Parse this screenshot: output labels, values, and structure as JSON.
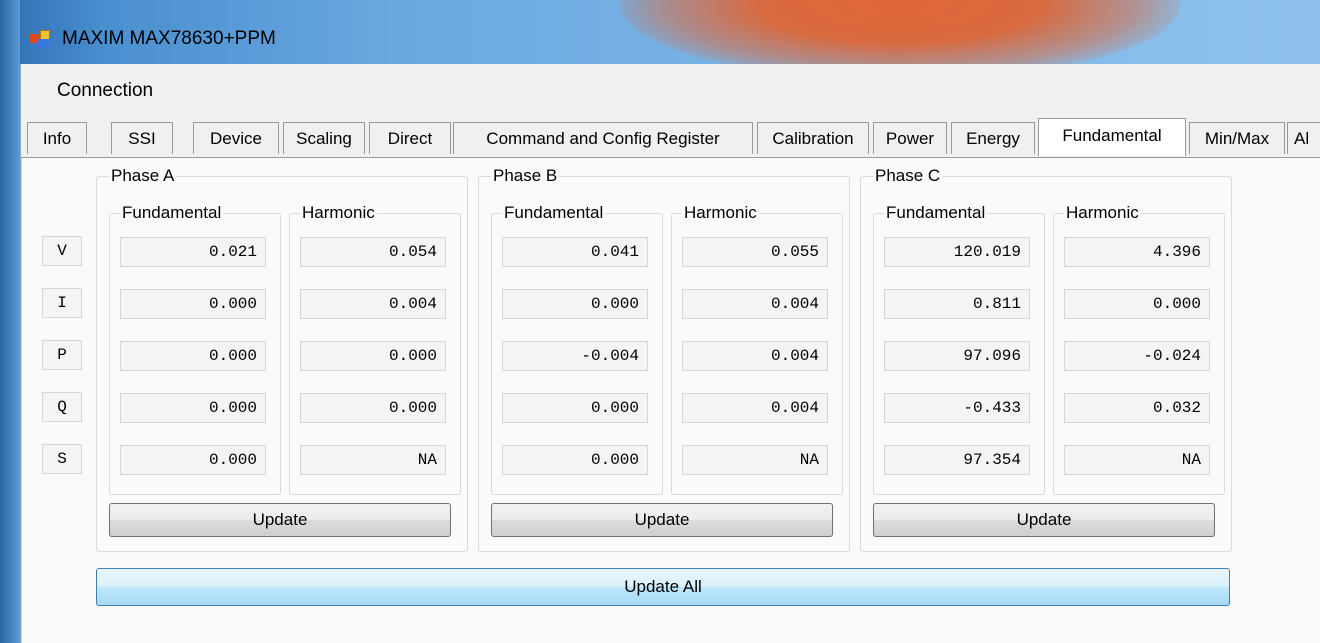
{
  "window": {
    "title": "MAXIM MAX78630+PPM"
  },
  "menu": {
    "connection": "Connection"
  },
  "tabs": [
    "Info",
    "SSI",
    "Device",
    "Scaling",
    "Direct",
    "Command and Config Register",
    "Calibration",
    "Power",
    "Energy",
    "Fundamental",
    "Min/Max",
    "Al"
  ],
  "active_tab": "Fundamental",
  "row_labels": [
    "V",
    "I",
    "P",
    "Q",
    "S"
  ],
  "phases": [
    {
      "label": "Phase A",
      "fundamental_label": "Fundamental",
      "harmonic_label": "Harmonic",
      "fundamental": [
        "0.021",
        "0.000",
        "0.000",
        "0.000",
        "0.000"
      ],
      "harmonic": [
        "0.054",
        "0.004",
        "0.000",
        "0.000",
        "NA"
      ],
      "update_label": "Update"
    },
    {
      "label": "Phase B",
      "fundamental_label": "Fundamental",
      "harmonic_label": "Harmonic",
      "fundamental": [
        "0.041",
        "0.000",
        "-0.004",
        "0.000",
        "0.000"
      ],
      "harmonic": [
        "0.055",
        "0.004",
        "0.004",
        "0.004",
        "NA"
      ],
      "update_label": "Update"
    },
    {
      "label": "Phase C",
      "fundamental_label": "Fundamental",
      "harmonic_label": "Harmonic",
      "fundamental": [
        "120.019",
        "0.811",
        "97.096",
        "-0.433",
        "97.354"
      ],
      "harmonic": [
        "4.396",
        "0.000",
        "-0.024",
        "0.032",
        "NA"
      ],
      "update_label": "Update"
    }
  ],
  "update_all_label": "Update All"
}
